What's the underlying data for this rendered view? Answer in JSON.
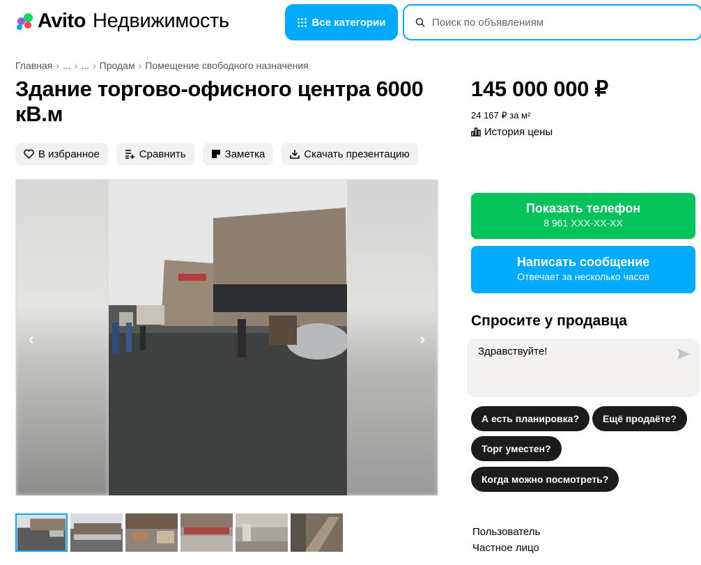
{
  "header": {
    "brand": "Avito",
    "section": "Недвижимость",
    "categories_button": "Все категории",
    "search_placeholder": "Поиск по объявлениям",
    "brand_colors": [
      "#04e061",
      "#965eeb",
      "#ff4053",
      "#00aaff"
    ]
  },
  "breadcrumb": [
    "Главная",
    "...",
    "...",
    "Продам",
    "Помещение свободного назначения"
  ],
  "listing": {
    "title": "Здание торгово-офисного центра 6000 кВ.м",
    "actions": {
      "favorite": "В избранное",
      "compare": "Сравнить",
      "note": "Заметка",
      "download": "Скачать презентацию"
    },
    "gallery": {
      "prev_icon": "chevron-left",
      "next_icon": "chevron-right"
    }
  },
  "price": {
    "amount": "145 000 000 ₽",
    "per_m2": "24 167 ₽ за м²",
    "history_label": "История цены"
  },
  "contact": {
    "phone_label": "Показать телефон",
    "phone_number": "8 961 XXX-XX-XX",
    "message_label": "Написать сообщение",
    "message_sub": "Отвечает за несколько часов",
    "phone_color": "#03c45a",
    "message_color": "#00aaff"
  },
  "ask_seller": {
    "heading": "Спросите у продавца",
    "message": "Здравствуйте!",
    "chips": [
      "А есть планировка?",
      "Ещё продаёте?",
      "Торг уместен?",
      "Когда можно посмотреть?"
    ]
  },
  "seller": {
    "name": "Пользователь",
    "type": "Частное лицо"
  }
}
